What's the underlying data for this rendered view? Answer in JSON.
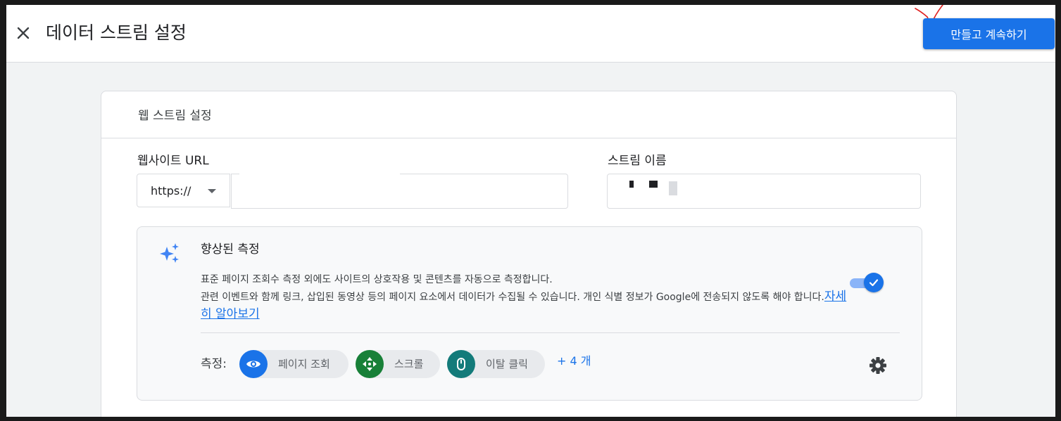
{
  "header": {
    "title": "데이터 스트림 설정",
    "primary_action": "만들고 계속하기"
  },
  "card": {
    "title": "웹 스트림 설정",
    "url_field": {
      "label": "웹사이트 URL",
      "protocol": "https://",
      "value": ""
    },
    "name_field": {
      "label": "스트림 이름",
      "value": ""
    },
    "enhanced": {
      "title": "향상된 측정",
      "description_line1": "표준 페이지 조회수 측정 외에도 사이트의 상호작용 및 콘텐츠를 자동으로 측정합니다.",
      "description_line2": "관련 이벤트와 함께 링크, 삽입된 동영상 등의 페이지 요소에서 데이터가 수집될 수 있습니다. 개인 식별 정보가 Google에 전송되지 않도록 해야 합니다.",
      "learn_more": "자세히 알아보기",
      "enabled": true,
      "measure_label": "측정:",
      "chips": [
        {
          "label": "페이지 조회",
          "icon": "eye-icon",
          "color": "#1a73e8"
        },
        {
          "label": "스크롤",
          "icon": "scroll-icon",
          "color": "#188038"
        },
        {
          "label": "이탈 클릭",
          "icon": "mouse-icon",
          "color": "#137b7a"
        }
      ],
      "more": "+ 4 개"
    }
  },
  "colors": {
    "primary": "#1a73e8",
    "background": "#f1f3f4",
    "annotation": "#e02020"
  }
}
